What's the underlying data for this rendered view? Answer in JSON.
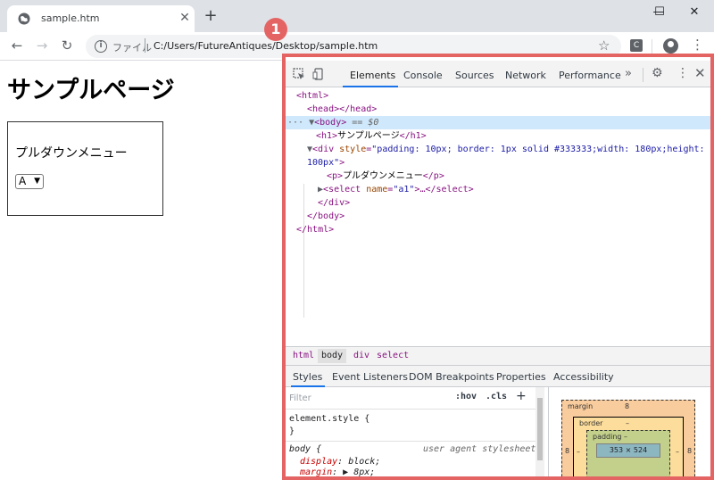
{
  "browser": {
    "tab_title": "sample.htm",
    "tab_close": "✕",
    "new_tab": "+",
    "window_controls": {
      "minimize": "—",
      "maximize": "☐",
      "close": "✕"
    },
    "nav": {
      "back": "←",
      "forward": "→",
      "reload": "↻"
    },
    "address_label": "ファイル",
    "address_url": "C:/Users/FutureAntiques/Desktop/sample.htm",
    "star": "☆",
    "extension_letter": "C",
    "menu": "⋮"
  },
  "page": {
    "heading": "サンプルページ",
    "paragraph": "プルダウンメニュー",
    "select_value": "A"
  },
  "devtools": {
    "badge": "1",
    "tabs": [
      "Elements",
      "Console",
      "Sources",
      "Network",
      "Performance"
    ],
    "more": "»",
    "gear": "⚙",
    "kebab": "⋮",
    "close": "✕",
    "dom": {
      "html_open": "<html>",
      "head": "<head></head>",
      "body_open": "<body>",
      "body_marker": "== $0",
      "h1_open": "<h1>",
      "h1_text": "サンプルページ",
      "h1_close": "</h1>",
      "div_open": "<div ",
      "div_attr_name": "style",
      "div_attr_value_1": "\"padding: 10px; border: 1px solid #333333;width: 180px;height:",
      "div_attr_value_2": "100px\"",
      "div_tag_end": ">",
      "p_open": "<p>",
      "p_text": "プルダウンメニュー",
      "p_close": "</p>",
      "select_open": "<select ",
      "select_attr_name": "name",
      "select_attr_value": "\"a1\"",
      "select_rest": ">…</select>",
      "div_close": "</div>",
      "body_close": "</body>",
      "html_close": "</html>"
    },
    "breadcrumbs": [
      "html",
      "body",
      "div",
      "select"
    ],
    "subtabs": [
      "Styles",
      "Event Listeners",
      "DOM Breakpoints",
      "Properties",
      "Accessibility"
    ],
    "styles": {
      "filter_placeholder": "Filter",
      "hov": ":hov",
      "cls": ".cls",
      "plus": "+",
      "element_style": "element.style {",
      "close_brace": "}",
      "body_rule": "body {",
      "ua_label": "user agent stylesheet",
      "decl_1_prop": "display",
      "decl_1_val": ": block;",
      "decl_2_prop": "margin",
      "decl_2_val": ": ▶ 8px;"
    },
    "box_model": {
      "margin_label": "margin",
      "margin_value": "8",
      "border_label": "border",
      "border_value": "–",
      "padding_label": "padding –",
      "content_size": "353 × 524",
      "side_left": "8",
      "side_right": "8",
      "dash_left": "–",
      "dash_right": "–"
    }
  }
}
